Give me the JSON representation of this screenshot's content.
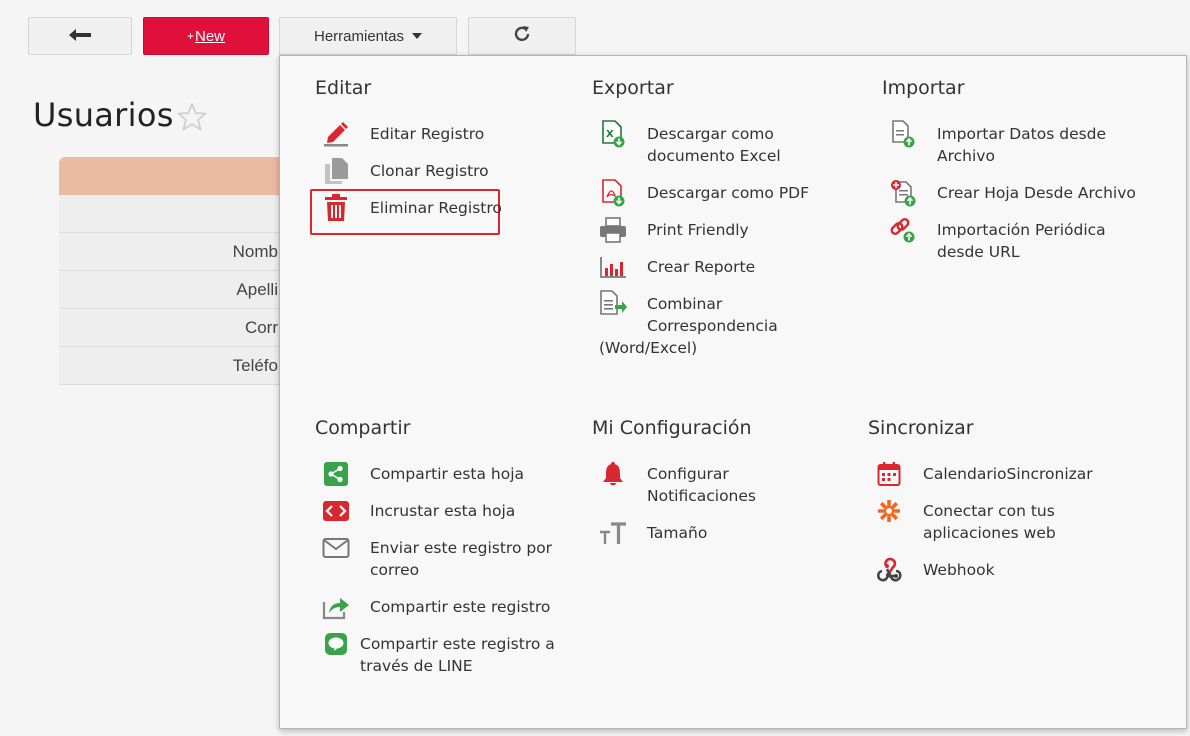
{
  "toolbar": {
    "back_icon": "arrow-left-icon",
    "new_plus": "+",
    "new_label": "New",
    "tools_label": "Herramientas",
    "reload_icon": "refresh-icon"
  },
  "page": {
    "title": "Usuarios",
    "star_icon": "star-outline-icon"
  },
  "record_rows": [
    "Nomb",
    "Apelli",
    "Corr",
    "Teléfo"
  ],
  "menu": {
    "editar": {
      "title": "Editar",
      "items": [
        {
          "label": "Editar Registro",
          "icon": "pencil-icon"
        },
        {
          "label": "Clonar Registro",
          "icon": "copy-icon"
        },
        {
          "label": "Eliminar Registro",
          "icon": "trash-icon"
        }
      ]
    },
    "exportar": {
      "title": "Exportar",
      "items": [
        {
          "label": "Descargar como documento Excel",
          "line1": "Descargar como",
          "line2": "documento Excel",
          "icon": "excel-download-icon"
        },
        {
          "label": "Descargar como PDF",
          "icon": "pdf-download-icon"
        },
        {
          "label": "Print Friendly",
          "icon": "printer-icon"
        },
        {
          "label": "Crear Reporte",
          "icon": "bar-chart-icon"
        },
        {
          "label": "Combinar Correspondencia (Word/Excel)",
          "line1": "Combinar",
          "line2": "Correspondencia",
          "line3": "(Word/Excel)",
          "icon": "merge-document-icon"
        }
      ]
    },
    "importar": {
      "title": "Importar",
      "items": [
        {
          "label": "Importar Datos desde Archivo",
          "line1": "Importar Datos desde",
          "line2": "Archivo",
          "icon": "import-file-icon"
        },
        {
          "label": "Crear Hoja Desde Archivo",
          "icon": "new-sheet-from-file-icon"
        },
        {
          "label": "Importación Periódica desde URL",
          "line1": "Importación Periódica",
          "line2": "desde URL",
          "icon": "link-import-icon"
        }
      ]
    },
    "compartir": {
      "title": "Compartir",
      "items": [
        {
          "label": "Compartir esta hoja",
          "icon": "share-icon"
        },
        {
          "label": "Incrustar esta hoja",
          "icon": "embed-code-icon"
        },
        {
          "label": "Enviar este registro por correo",
          "line1": "Enviar este registro por",
          "line2": "correo",
          "icon": "mail-icon"
        },
        {
          "label": "Compartir este registro",
          "icon": "share-arrow-icon"
        },
        {
          "label": "Compartir este registro a través de LINE",
          "line1": "Compartir este registro a",
          "line2": "través de LINE",
          "icon": "line-app-icon"
        }
      ]
    },
    "configuracion": {
      "title": "Mi Configuración",
      "items": [
        {
          "label": "Configurar Notificaciones",
          "line1": "Configurar",
          "line2": "Notificaciones",
          "icon": "bell-icon"
        },
        {
          "label": "Tamaño",
          "icon": "text-size-icon"
        }
      ]
    },
    "sincronizar": {
      "title": "Sincronizar",
      "items": [
        {
          "label": "CalendarioSincronizar",
          "icon": "calendar-icon"
        },
        {
          "label": "Conectar con tus aplicaciones web",
          "line1": "Conectar con tus",
          "line2": "aplicaciones web",
          "icon": "zapier-icon"
        },
        {
          "label": "Webhook",
          "icon": "webhook-icon"
        }
      ]
    }
  },
  "colors": {
    "accent_red": "#e0103a",
    "highlight_border": "#d9272e",
    "header_peach": "#ebbaa3"
  }
}
